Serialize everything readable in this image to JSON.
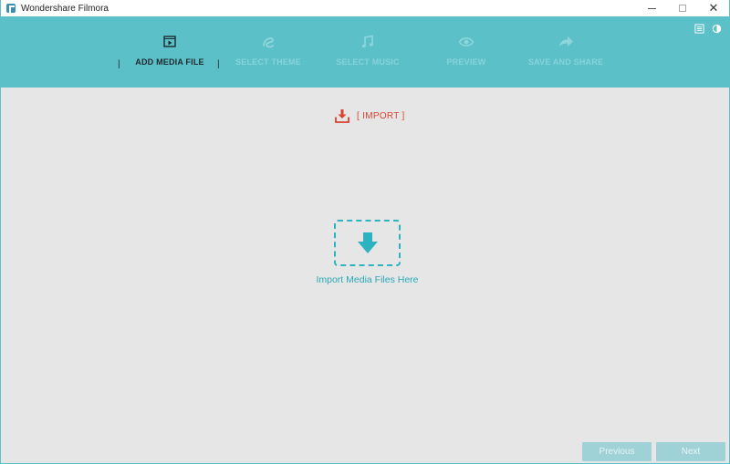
{
  "window": {
    "title": "Wondershare Filmora",
    "controls": {
      "minimize": "",
      "maximize": "",
      "close": "✕"
    }
  },
  "steps": [
    {
      "label": "ADD MEDIA FILE",
      "icon": "film-play-icon",
      "active": true
    },
    {
      "label": "SELECT THEME",
      "icon": "theme-ribbon-icon",
      "active": false
    },
    {
      "label": "SELECT MUSIC",
      "icon": "music-note-icon",
      "active": false
    },
    {
      "label": "PREVIEW",
      "icon": "eye-icon",
      "active": false
    },
    {
      "label": "SAVE AND SHARE",
      "icon": "share-arrow-icon",
      "active": false
    }
  ],
  "separators": {
    "left": "|",
    "right": "|"
  },
  "header_icons": [
    "list-menu-icon",
    "brightness-icon"
  ],
  "import": {
    "label": "[ IMPORT ]",
    "icon": "download-icon",
    "color": "#d9432f"
  },
  "dropzone": {
    "label": "Import Media Files Here",
    "icon": "down-arrow-icon",
    "color": "#2db2c0"
  },
  "footer": {
    "previous": "Previous",
    "next": "Next"
  },
  "colors": {
    "header": "#5cc0c9",
    "background": "#e6e6e6",
    "button": "#9fd2d7"
  }
}
